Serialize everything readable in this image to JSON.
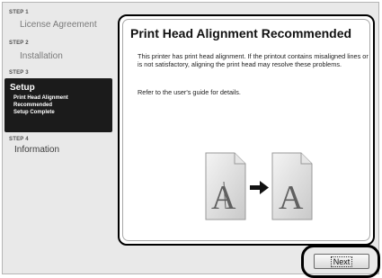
{
  "steps": [
    {
      "tag": "STEP 1",
      "name": "License Agreement"
    },
    {
      "tag": "STEP 2",
      "name": "Installation"
    },
    {
      "tag": "STEP 3",
      "name": "Setup",
      "substeps": [
        "Print Head Alignment",
        "Recommended",
        "Setup Complete"
      ]
    },
    {
      "tag": "STEP 4",
      "name": "Information"
    }
  ],
  "panel": {
    "title": "Print Head Alignment Recommended",
    "body1": "This printer has print head alignment. If the printout contains misaligned lines or is not satisfactory, aligning the print head may resolve these problems.",
    "body2": "Refer to the user's guide for details.",
    "illustration": {
      "letter_before": "A",
      "letter_after": "A",
      "icon": "arrow-right-icon"
    }
  },
  "footer": {
    "next_label": "Next"
  }
}
